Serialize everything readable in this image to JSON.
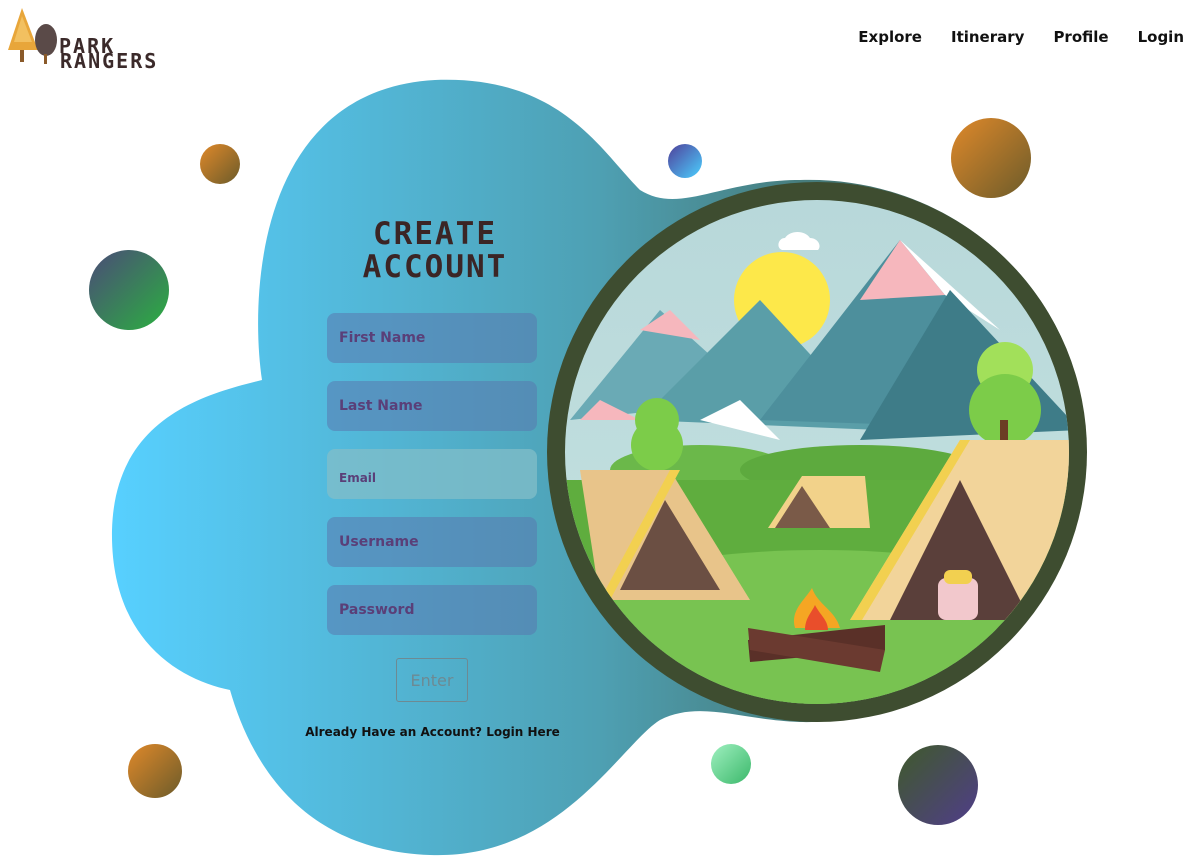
{
  "header": {
    "logo_line1": "PARK",
    "logo_line2": "RANGERS",
    "nav": [
      {
        "label": "Explore"
      },
      {
        "label": "Itinerary"
      },
      {
        "label": "Profile"
      },
      {
        "label": "Login"
      }
    ]
  },
  "form": {
    "title_line1": "CREATE",
    "title_line2": "ACCOUNT",
    "first_name_placeholder": "First Name",
    "last_name_placeholder": "Last Name",
    "email_placeholder": "Email",
    "username_placeholder": "Username",
    "password_placeholder": "Password",
    "enter_label": "Enter",
    "login_link": "Already Have an Account? Login Here"
  },
  "colors": {
    "blob_left": "#59d0ff",
    "blob_right": "#3f5237",
    "title": "#3b2525"
  }
}
